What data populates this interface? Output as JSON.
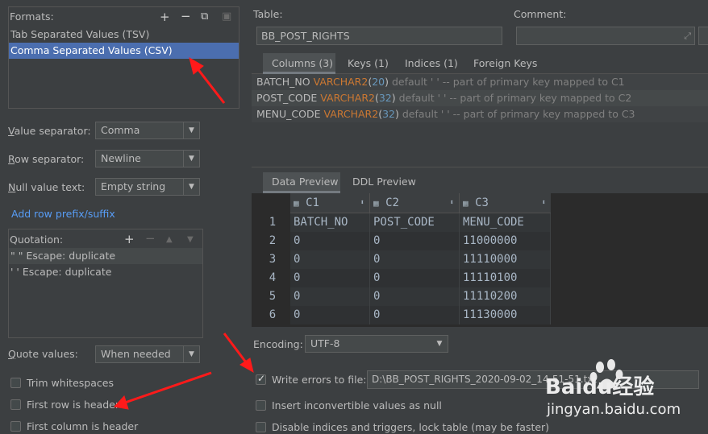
{
  "left": {
    "formats_label": "Formats:",
    "formats": [
      {
        "label": "Tab Separated Values (TSV)",
        "selected": false
      },
      {
        "label": "Comma Separated Values (CSV)",
        "selected": true
      }
    ],
    "value_separator_label": "Value separator:",
    "value_separator": "Comma",
    "row_separator_label": "Row separator:",
    "row_separator": "Newline",
    "null_value_label": "Null value text:",
    "null_value": "Empty string",
    "add_prefix_link": "Add row prefix/suffix",
    "quotation_label": "Quotation:",
    "quotations": [
      "\" \"  Escape: duplicate",
      "' '  Escape: duplicate"
    ],
    "quote_values_label": "Quote values:",
    "quote_values": "When needed",
    "trim_whitespaces": "Trim whitespaces",
    "first_row_header": "First row is header",
    "first_column_header": "First column is header"
  },
  "right": {
    "table_label": "Table:",
    "table_value": "BB_POST_RIGHTS",
    "comment_label": "Comment:",
    "tabs": [
      "Columns (3)",
      "Keys (1)",
      "Indices (1)",
      "Foreign Keys"
    ],
    "columns": [
      {
        "name": "BATCH_NO",
        "type": "VARCHAR2",
        "len": "20",
        "rest": "default ' ' -- part of primary key mapped to C1"
      },
      {
        "name": "POST_CODE",
        "type": "VARCHAR2",
        "len": "32",
        "rest": "default ' ' -- part of primary key mapped to C2"
      },
      {
        "name": "MENU_CODE",
        "type": "VARCHAR2",
        "len": "32",
        "rest": "default ' ' -- part of primary key mapped to C3"
      }
    ],
    "preview_tabs": [
      "Data Preview",
      "DDL Preview"
    ],
    "grid_headers": [
      "C1",
      "C2",
      "C3"
    ],
    "grid_rows": [
      {
        "n": "1",
        "c": [
          "BATCH_NO",
          "POST_CODE",
          "MENU_CODE"
        ]
      },
      {
        "n": "2",
        "c": [
          "0",
          "0",
          "11000000"
        ]
      },
      {
        "n": "3",
        "c": [
          "0",
          "0",
          "11110000"
        ]
      },
      {
        "n": "4",
        "c": [
          "0",
          "0",
          "11110100"
        ]
      },
      {
        "n": "5",
        "c": [
          "0",
          "0",
          "11110200"
        ]
      },
      {
        "n": "6",
        "c": [
          "0",
          "0",
          "11130000"
        ]
      }
    ],
    "encoding_label": "Encoding:",
    "encoding_value": "UTF-8",
    "write_errors_label": "Write errors to file:",
    "write_errors_path": "D:\\BB_POST_RIGHTS_2020-09-02_14-51-51.txt",
    "insert_null_label": "Insert inconvertible values as null",
    "disable_indices_label": "Disable indices and triggers, lock table (may be faster)"
  },
  "watermark": {
    "brand": "Baidu经验",
    "url": "jingyan.baidu.com"
  },
  "colors": {
    "background": "#3c3f41",
    "selection": "#4b6eaf",
    "keyword": "#cc7832",
    "number": "#6897bb",
    "link": "#589df6",
    "annotation_arrow": "#ff1a1a"
  }
}
